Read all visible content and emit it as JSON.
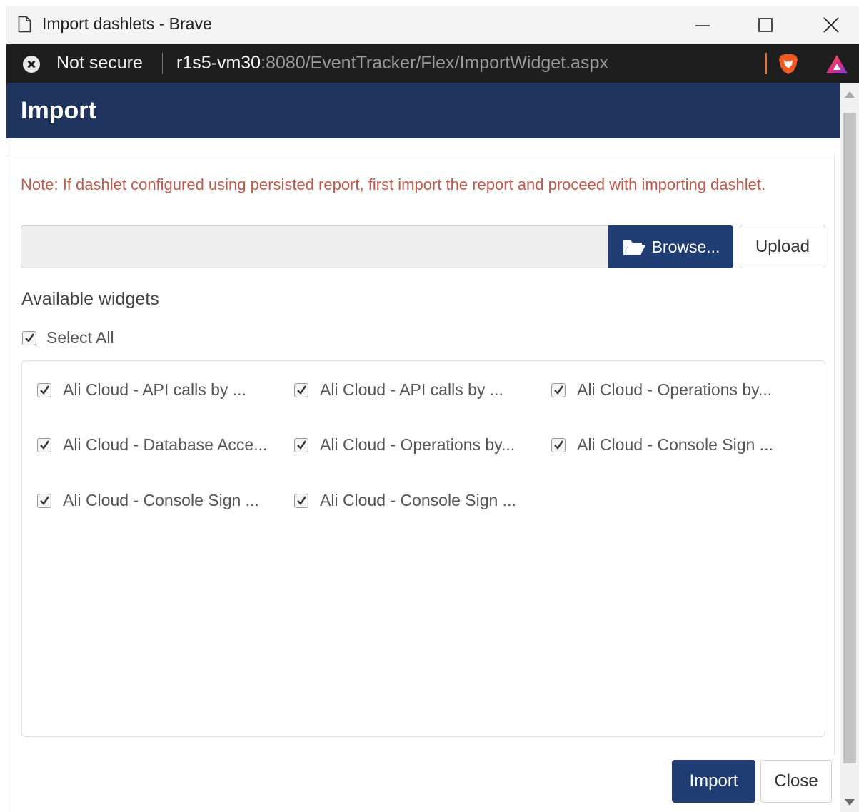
{
  "window": {
    "title": "Import dashlets - Brave"
  },
  "addressbar": {
    "security_label": "Not secure",
    "url_host": "r1s5-vm30",
    "url_rest": ":8080/EventTracker/Flex/ImportWidget.aspx"
  },
  "modal": {
    "title": "Import",
    "note": "Note: If dashlet configured using persisted report, first import the report and proceed with importing dashlet.",
    "file_input_value": "",
    "browse_label": "Browse...",
    "upload_label": "Upload",
    "section_title": "Available widgets",
    "select_all_label": "Select All",
    "select_all_checked": true,
    "widgets": [
      {
        "label": "Ali Cloud - API calls by ...",
        "checked": true
      },
      {
        "label": "Ali Cloud - API calls by ...",
        "checked": true
      },
      {
        "label": "Ali Cloud - Operations by...",
        "checked": true
      },
      {
        "label": "Ali Cloud - Database Acce...",
        "checked": true
      },
      {
        "label": "Ali Cloud - Operations by...",
        "checked": true
      },
      {
        "label": "Ali Cloud - Console Sign ...",
        "checked": true
      },
      {
        "label": "Ali Cloud - Console Sign ...",
        "checked": true
      },
      {
        "label": "Ali Cloud - Console Sign ...",
        "checked": true
      }
    ],
    "import_label": "Import",
    "close_label": "Close"
  },
  "colors": {
    "header_bg": "#1f3560",
    "primary_button": "#1f3c73",
    "note_text": "#c4574a",
    "addressbar_bg": "#1e1e1e"
  },
  "icons": {
    "page": "document-icon",
    "security": "not-secure-icon",
    "browser": "brave-lion-icon",
    "rewards": "brave-rewards-icon",
    "browse": "folder-open-icon",
    "checkbox": "checkmark-icon"
  }
}
